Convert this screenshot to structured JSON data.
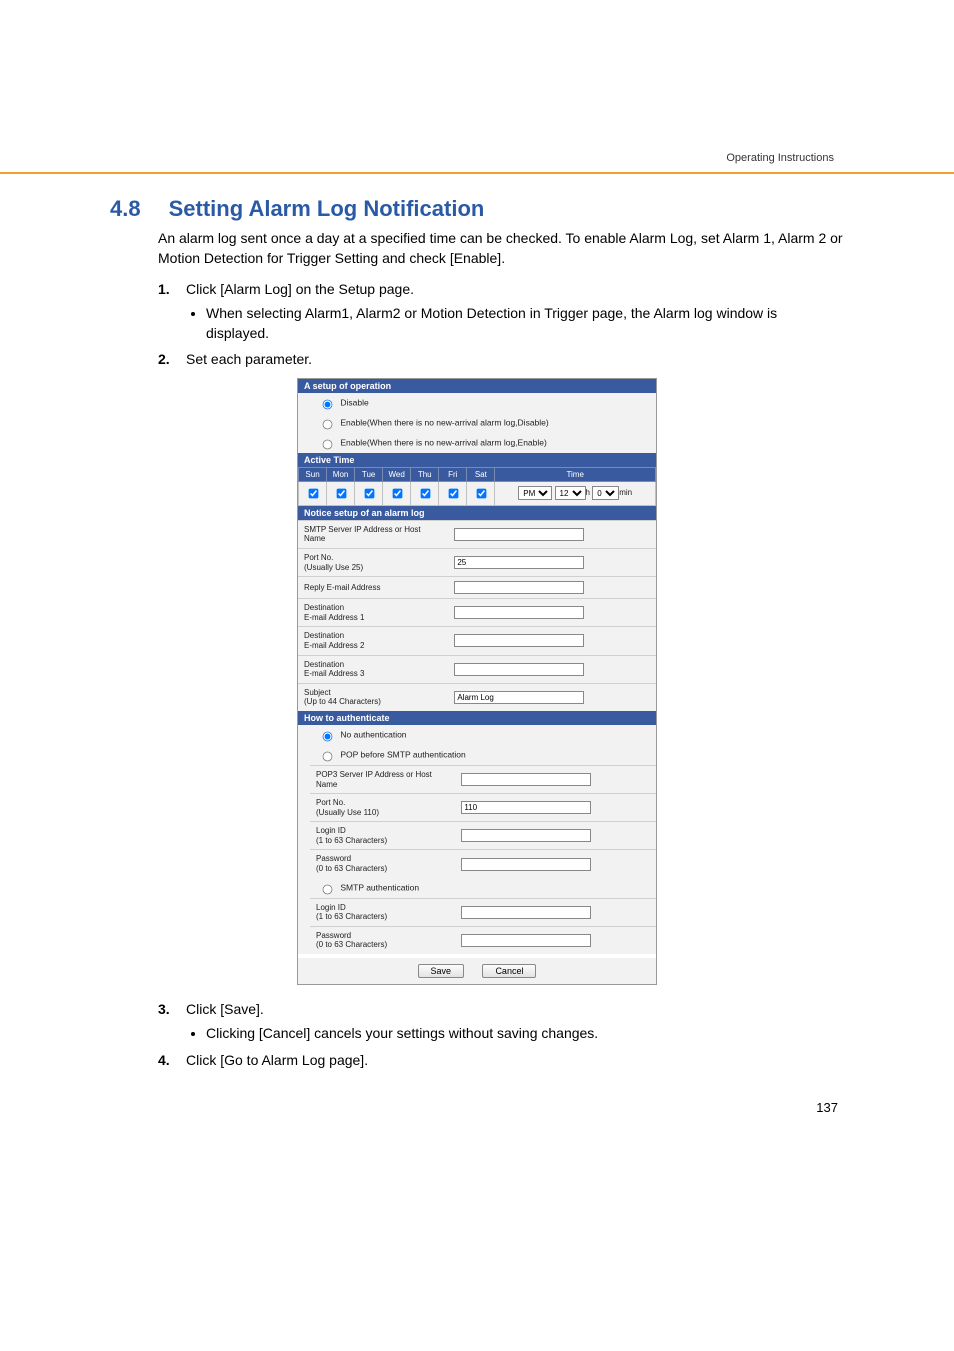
{
  "header": {
    "doc_label": "Operating Instructions"
  },
  "section": {
    "number": "4.8",
    "title": "Setting Alarm Log Notification",
    "intro": "An alarm log sent once a day at a specified time can be checked. To enable Alarm Log, set Alarm 1, Alarm 2 or Motion Detection for Trigger Setting and check [Enable]."
  },
  "steps": [
    {
      "num": "1.",
      "text": "Click [Alarm Log] on the Setup page.",
      "sub": [
        "When selecting Alarm1, Alarm2 or Motion Detection in Trigger page, the Alarm log window is displayed."
      ]
    },
    {
      "num": "2.",
      "text": "Set each parameter."
    },
    {
      "num": "3.",
      "text": "Click [Save].",
      "sub": [
        "Clicking [Cancel] cancels your settings without saving changes."
      ]
    },
    {
      "num": "4.",
      "text": "Click [Go to Alarm Log page]."
    }
  ],
  "shot": {
    "headings": {
      "op": "A setup of operation",
      "active": "Active Time",
      "notice": "Notice setup of an alarm log",
      "auth": "How to authenticate"
    },
    "op": {
      "disable": "Disable",
      "enable_off": "Enable(When there is no new-arrival alarm log,Disable)",
      "enable_on": "Enable(When there is no new-arrival alarm log,Enable)"
    },
    "days": {
      "sun": "Sun",
      "mon": "Mon",
      "tue": "Tue",
      "wed": "Wed",
      "thu": "Thu",
      "fri": "Fri",
      "sat": "Sat",
      "time": "Time"
    },
    "time": {
      "ampm": "PM",
      "hour": "12",
      "h": "h",
      "min": "0",
      "m": "min"
    },
    "fields": {
      "smtp": "SMTP Server IP Address or Host Name",
      "port25": "Port No.\n(Usually Use 25)",
      "port25_value": "25",
      "reply": "Reply E-mail Address",
      "dest1": "Destination\nE-mail Address 1",
      "dest2": "Destination\nE-mail Address 2",
      "dest3": "Destination\nE-mail Address 3",
      "subject": "Subject\n(Up to 44 Characters)",
      "subject_value": "Alarm Log"
    },
    "auth": {
      "none": "No authentication",
      "pop": "POP before SMTP authentication",
      "pop3": "POP3 Server IP Address or Host Name",
      "port110": "Port No.\n(Usually Use 110)",
      "port110_value": "110",
      "login": "Login ID\n(1 to 63 Characters)",
      "password": "Password\n(0 to 63 Characters)",
      "smtp": "SMTP authentication",
      "login2": "Login ID\n(1 to 63 Characters)",
      "password2": "Password\n(0 to 63 Characters)"
    },
    "buttons": {
      "save": "Save",
      "cancel": "Cancel"
    }
  },
  "page_number": "137"
}
